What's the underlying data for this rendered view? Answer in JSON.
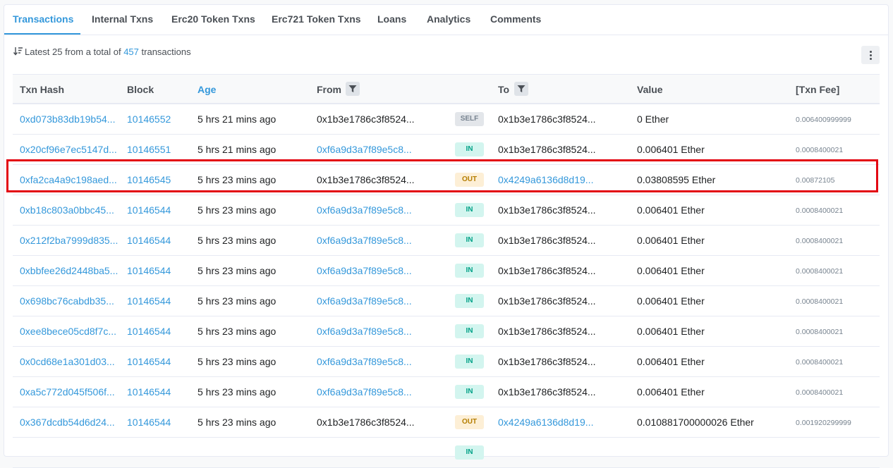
{
  "tabs": [
    {
      "label": "Transactions"
    },
    {
      "label": "Internal Txns"
    },
    {
      "label": "Erc20 Token Txns"
    },
    {
      "label": "Erc721 Token Txns"
    },
    {
      "label": "Loans"
    },
    {
      "label": "Analytics"
    },
    {
      "label": "Comments"
    }
  ],
  "summary": {
    "prefix": "Latest 25 from a total of",
    "count": "457",
    "suffix": "transactions"
  },
  "table": {
    "headers": {
      "txn_hash": "Txn Hash",
      "block": "Block",
      "age": "Age",
      "from": "From",
      "to": "To",
      "value": "Value",
      "fee": "[Txn Fee]"
    },
    "rows": [
      {
        "hash": "0xd073b83db19b54...",
        "block": "10146552",
        "age": "5 hrs 21 mins ago",
        "from": "0x1b3e1786c3f8524...",
        "dir": "SELF",
        "to": "0x1b3e1786c3f8524...",
        "value": "0 Ether",
        "fee": "0.006400999999"
      },
      {
        "hash": "0x20cf96e7ec5147d...",
        "block": "10146551",
        "age": "5 hrs 21 mins ago",
        "from": "0xf6a9d3a7f89e5c8...",
        "dir": "IN",
        "to": "0x1b3e1786c3f8524...",
        "value": "0.006401 Ether",
        "fee": "0.0008400021"
      },
      {
        "hash": "0xfa2ca4a9c198aed...",
        "block": "10146545",
        "age": "5 hrs 23 mins ago",
        "from": "0x1b3e1786c3f8524...",
        "dir": "OUT",
        "to": "0x4249a6136d8d19...",
        "value": "0.03808595 Ether",
        "fee": "0.00872105"
      },
      {
        "hash": "0xb18c803a0bbc45...",
        "block": "10146544",
        "age": "5 hrs 23 mins ago",
        "from": "0xf6a9d3a7f89e5c8...",
        "dir": "IN",
        "to": "0x1b3e1786c3f8524...",
        "value": "0.006401 Ether",
        "fee": "0.0008400021"
      },
      {
        "hash": "0x212f2ba7999d835...",
        "block": "10146544",
        "age": "5 hrs 23 mins ago",
        "from": "0xf6a9d3a7f89e5c8...",
        "dir": "IN",
        "to": "0x1b3e1786c3f8524...",
        "value": "0.006401 Ether",
        "fee": "0.0008400021"
      },
      {
        "hash": "0xbbfee26d2448ba5...",
        "block": "10146544",
        "age": "5 hrs 23 mins ago",
        "from": "0xf6a9d3a7f89e5c8...",
        "dir": "IN",
        "to": "0x1b3e1786c3f8524...",
        "value": "0.006401 Ether",
        "fee": "0.0008400021"
      },
      {
        "hash": "0x698bc76cabdb35...",
        "block": "10146544",
        "age": "5 hrs 23 mins ago",
        "from": "0xf6a9d3a7f89e5c8...",
        "dir": "IN",
        "to": "0x1b3e1786c3f8524...",
        "value": "0.006401 Ether",
        "fee": "0.0008400021"
      },
      {
        "hash": "0xee8bece05cd8f7c...",
        "block": "10146544",
        "age": "5 hrs 23 mins ago",
        "from": "0xf6a9d3a7f89e5c8...",
        "dir": "IN",
        "to": "0x1b3e1786c3f8524...",
        "value": "0.006401 Ether",
        "fee": "0.0008400021"
      },
      {
        "hash": "0x0cd68e1a301d03...",
        "block": "10146544",
        "age": "5 hrs 23 mins ago",
        "from": "0xf6a9d3a7f89e5c8...",
        "dir": "IN",
        "to": "0x1b3e1786c3f8524...",
        "value": "0.006401 Ether",
        "fee": "0.0008400021"
      },
      {
        "hash": "0xa5c772d045f506f...",
        "block": "10146544",
        "age": "5 hrs 23 mins ago",
        "from": "0xf6a9d3a7f89e5c8...",
        "dir": "IN",
        "to": "0x1b3e1786c3f8524...",
        "value": "0.006401 Ether",
        "fee": "0.0008400021"
      },
      {
        "hash": "0x367dcdb54d6d24...",
        "block": "10146544",
        "age": "5 hrs 23 mins ago",
        "from": "0x1b3e1786c3f8524...",
        "dir": "OUT",
        "to": "0x4249a6136d8d19...",
        "value": "0.010881700000026 Ether",
        "fee": "0.001920299999"
      },
      {
        "hash": "",
        "block": "",
        "age": "",
        "from": "",
        "dir": "IN",
        "to": "",
        "value": "",
        "fee": ""
      }
    ]
  },
  "colors": {
    "accent": "#3498db",
    "highlight": "#e30613",
    "in_badge": "#d3f5ef",
    "out_badge": "#fdefd6",
    "self_badge": "#e3e6ea"
  },
  "icons": [
    "sort-icon",
    "more-icon",
    "filter-icon"
  ]
}
